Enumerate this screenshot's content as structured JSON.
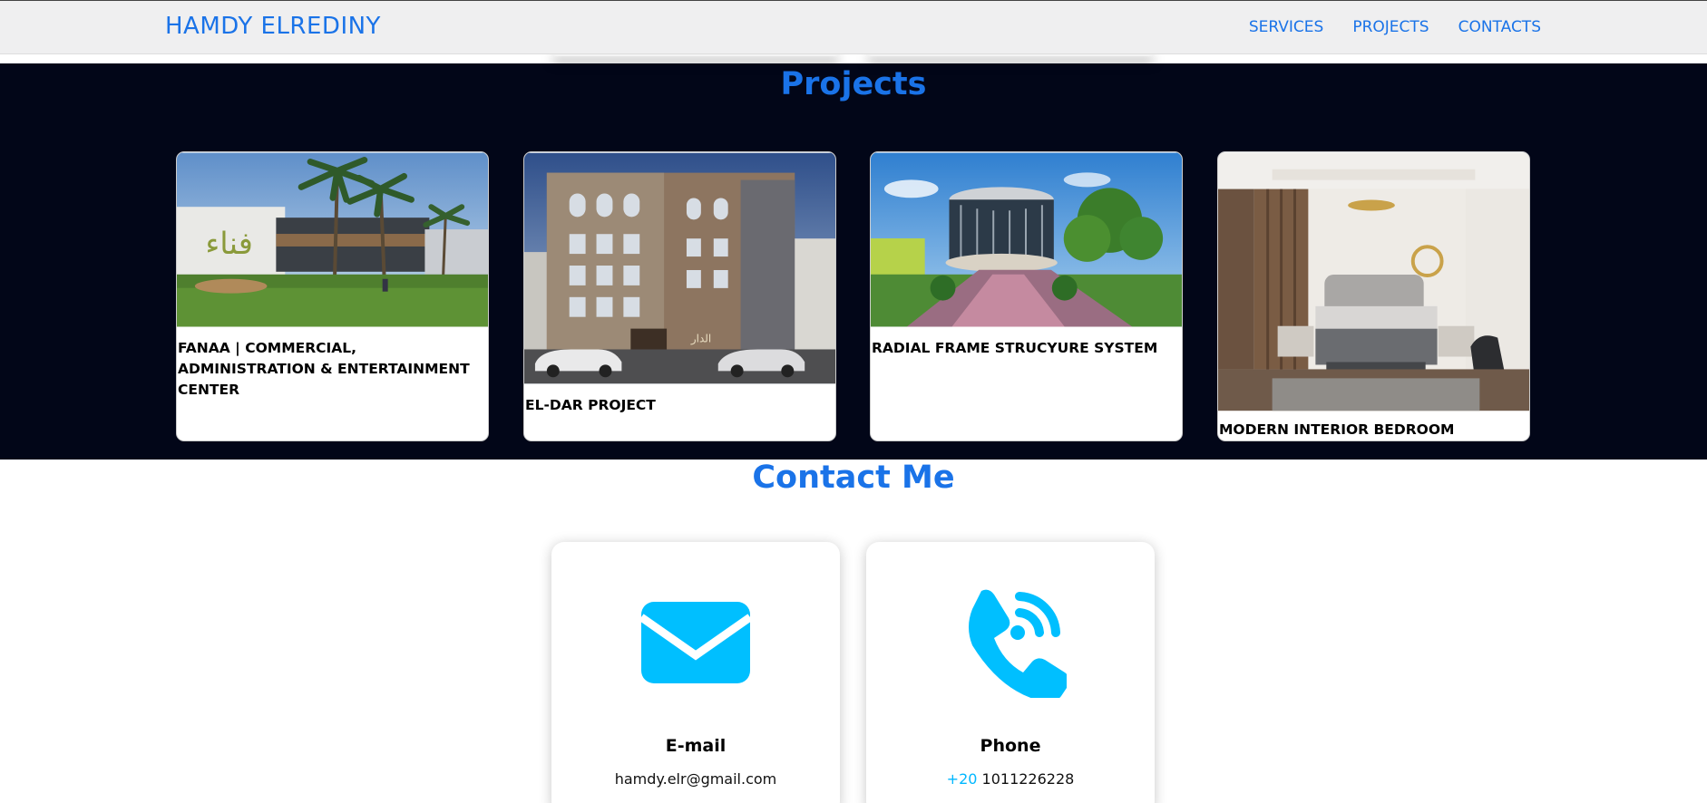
{
  "nav": {
    "brand": "HAMDY ELREDINY",
    "links": [
      "SERVICES",
      "PROJECTS",
      "CONTACTS"
    ]
  },
  "projects": {
    "title": "Projects",
    "cards": [
      {
        "title": "FANAA | COMMERCIAL, ADMINISTRATION & ENTERTAINMENT CENTER",
        "sign_text": "فناء"
      },
      {
        "title": "EL-DAR PROJECT",
        "sign_text": "الدار"
      },
      {
        "title": "RADIAL FRAME STRUCYURE SYSTEM"
      },
      {
        "title": "MODERN INTERIOR BEDROOM"
      }
    ]
  },
  "contact": {
    "title": "Contact Me",
    "email": {
      "label": "E-mail",
      "value": "hamdy.elr@gmail.com",
      "icon": "envelope-icon"
    },
    "phone": {
      "label": "Phone",
      "country_code": "+20",
      "number": "1011226228",
      "icon": "phone-wifi-icon"
    }
  },
  "colors": {
    "accent": "#1a73e8",
    "icon": "#00bfff",
    "dark_bg": "#020618"
  }
}
